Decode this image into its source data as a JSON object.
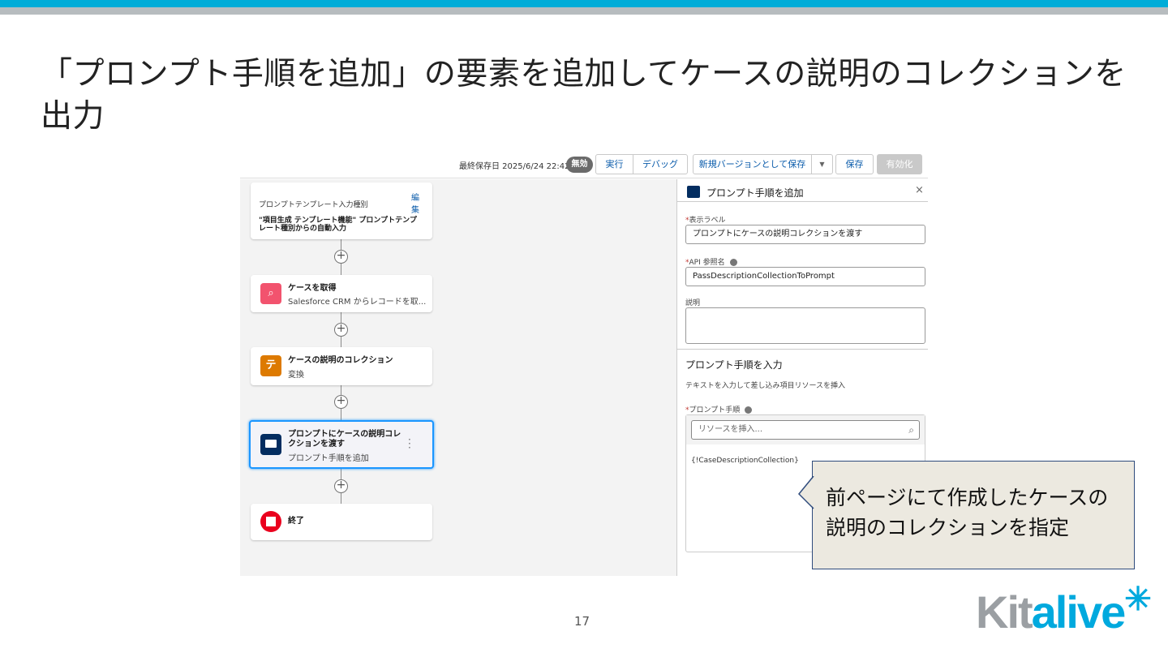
{
  "slide": {
    "title": "「プロンプト手順を追加」の要素を追加してケースの説明のコレクションを出力",
    "page_number": "17",
    "callout": "前ページにて作成したケースの説明のコレクションを指定",
    "logo_text": "Kitalive",
    "accent": "#00acd8"
  },
  "toolbar": {
    "last_saved": "最終保存日 2025/6/24 22:42",
    "status_badge": "無効",
    "run": "実行",
    "debug": "デバッグ",
    "save_new_version": "新規バージョンとして保存",
    "save": "保存",
    "activate": "有効化"
  },
  "flow": {
    "start_card": {
      "label": "プロンプトテンプレート入力種別",
      "edit": "編集",
      "value": "\"項目生成 テンプレート機能\" プロンプトテンプレート種別からの自動入力"
    },
    "nodes": [
      {
        "title": "ケースを取得",
        "subtitle": "Salesforce CRM からレコードを取...",
        "color": "#f2536e",
        "icon": "get-records-icon"
      },
      {
        "title": "ケースの説明のコレクション",
        "subtitle": "変換",
        "color": "#dd7a01",
        "icon": "transform-icon"
      },
      {
        "title": "プロンプトにケースの説明コレクションを渡す",
        "subtitle": "プロンプト手順を追加",
        "color": "#032d60",
        "icon": "prompt-icon"
      },
      {
        "title": "終了",
        "color": "#ea001e",
        "icon": "end-icon"
      }
    ]
  },
  "panel": {
    "title": "プロンプト手順を追加",
    "label_label": "表示ラベル",
    "label_value": "プロンプトにケースの説明コレクションを渡す",
    "api_label": "API 参照名",
    "api_value": "PassDescriptionCollectionToPrompt",
    "desc_label": "説明",
    "section_title": "プロンプト手順を入力",
    "section_help": "テキストを入力して差し込み項目リソースを挿入",
    "prompt_label": "プロンプト手順",
    "resource_placeholder": "リソースを挿入...",
    "prompt_value": "{!CaseDescriptionCollection}"
  }
}
